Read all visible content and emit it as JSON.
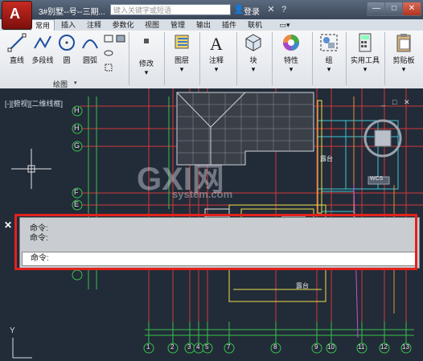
{
  "titlebar": {
    "title": "3#别墅--号--三期...",
    "search_placeholder": "键入关键字或短语",
    "login_label": "登录",
    "min_label": "—",
    "max_label": "□",
    "close_label": "✕"
  },
  "tabs": [
    "常用",
    "插入",
    "注释",
    "参数化",
    "视图",
    "管理",
    "输出",
    "插件",
    "联机"
  ],
  "ribbon": {
    "draw": {
      "line": "直线",
      "polyline": "多段线",
      "circle": "圆",
      "arc": "圆弧",
      "panel": "绘图"
    },
    "modify": "修改",
    "layers": "图层",
    "annotation": "注释",
    "block": "块",
    "properties": "特性",
    "group": "组",
    "utilities": "实用工具",
    "clipboard": "剪贴板"
  },
  "viewport": {
    "label": "[-][俯视][二维线框]",
    "min": "_",
    "max": "□",
    "close": "✕"
  },
  "axes_left": [
    "H",
    "H",
    "G",
    "F",
    "E"
  ],
  "axes_bottom": [
    "1",
    "2",
    "3",
    "4",
    "5",
    "7",
    "8",
    "9",
    "10",
    "11",
    "12",
    "13"
  ],
  "room_labels": [
    "露台",
    "露台"
  ],
  "wcs_label": "WCS",
  "command": {
    "close": "✕",
    "history": [
      "命令:",
      "命令:"
    ],
    "prompt": "命令:"
  },
  "watermark": {
    "logo": "GXI网",
    "domain": "system.com"
  },
  "ucs_y": "Y"
}
